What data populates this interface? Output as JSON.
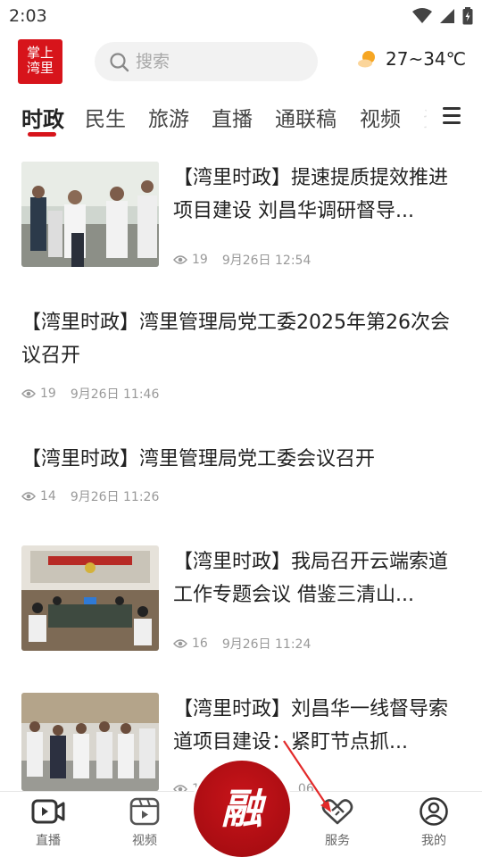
{
  "status_bar": {
    "time": "2:03",
    "icons": [
      "wifi-icon",
      "signal-icon",
      "battery-icon"
    ]
  },
  "header": {
    "logo_lines": [
      "掌上",
      "湾里"
    ],
    "search": {
      "placeholder": "搜索"
    },
    "weather": {
      "icon": "sunny-cloud-icon",
      "text": "27~34℃"
    }
  },
  "tabs": {
    "items": [
      {
        "label": "时政",
        "active": true
      },
      {
        "label": "民生"
      },
      {
        "label": "旅游"
      },
      {
        "label": "直播"
      },
      {
        "label": "通联稿"
      },
      {
        "label": "视频"
      },
      {
        "label": "资"
      }
    ],
    "more_icon": "menu-icon",
    "accent": "#d7141b"
  },
  "articles": [
    {
      "title": "【湾里时政】提速提质提效推进项目建设 刘昌华调研督导...",
      "views": "19",
      "time": "9月26日 12:54",
      "has_image": true
    },
    {
      "title": "【湾里时政】湾里管理局党工委2025年第26次会议召开",
      "views": "19",
      "time": "9月26日 11:46",
      "has_image": false
    },
    {
      "title": "【湾里时政】湾里管理局党工委会议召开",
      "views": "14",
      "time": "9月26日 11:26",
      "has_image": false
    },
    {
      "title": "【湾里时政】我局召开云端索道工作专题会议 借鉴三清山...",
      "views": "16",
      "time": "9月26日 11:24",
      "has_image": true
    },
    {
      "title": "【湾里时政】刘昌华一线督导索道项目建设：紧盯节点抓...",
      "views": "1",
      "time": "06",
      "has_image": true
    }
  ],
  "bottom_nav": {
    "items": [
      {
        "label": "直播",
        "icon": "video-camera-icon"
      },
      {
        "label": "视频",
        "icon": "video-player-icon"
      },
      {
        "label": "服务",
        "icon": "handshake-icon"
      },
      {
        "label": "我的",
        "icon": "user-profile-icon"
      }
    ],
    "center_glyph": "融"
  }
}
